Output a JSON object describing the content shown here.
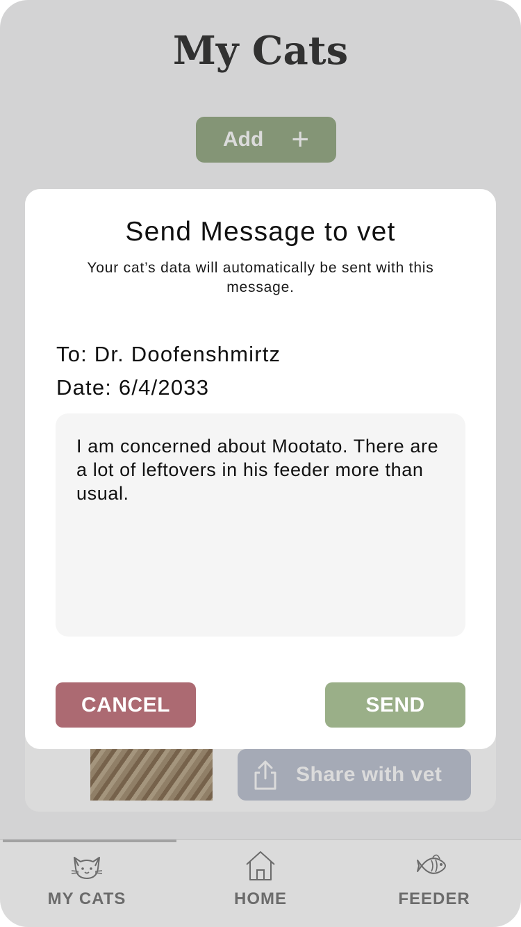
{
  "background": {
    "page_title": "My Cats",
    "add_button_label": "Add",
    "add_icon": "plus-icon",
    "share_button_label": "Share with vet",
    "share_icon": "share-icon"
  },
  "tabs": [
    {
      "label": "MY CATS",
      "icon": "cat-icon",
      "active": true
    },
    {
      "label": "HOME",
      "icon": "home-icon",
      "active": false
    },
    {
      "label": "FEEDER",
      "icon": "fish-icon",
      "active": false
    }
  ],
  "modal": {
    "title": "Send Message to vet",
    "subtitle": "Your cat’s data will automatically be sent with this message.",
    "to": "To: Dr. Doofenshmirtz",
    "date": "Date: 6/4/2033",
    "message": "I am concerned about Mootato. There are a lot of leftovers in his feeder more than usual.",
    "cancel_label": "CANCEL",
    "send_label": "SEND"
  },
  "colors": {
    "cancel": "#ac6a72",
    "send": "#9aaf88",
    "share": "#c0c6d4"
  }
}
